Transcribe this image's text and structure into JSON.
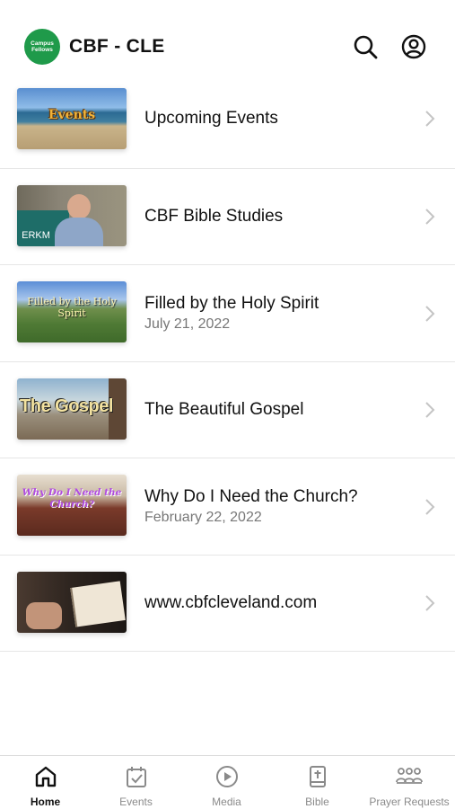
{
  "header": {
    "logo_line1": "Campus",
    "logo_line2": "Fellows",
    "title": "CBF - CLE",
    "search_icon": "search-icon",
    "profile_icon": "profile-icon"
  },
  "items": [
    {
      "title": "Upcoming Events",
      "subtitle": "",
      "thumb_text": "Events"
    },
    {
      "title": "CBF Bible Studies",
      "subtitle": "",
      "thumb_text": "ERKM"
    },
    {
      "title": "Filled by the Holy Spirit",
      "subtitle": "July 21, 2022",
      "thumb_text": "Filled by the Holy Spirit"
    },
    {
      "title": "The Beautiful Gospel",
      "subtitle": "",
      "thumb_text": "The Gospel"
    },
    {
      "title": "Why Do I Need the Church?",
      "subtitle": "February 22, 2022",
      "thumb_text": "Why Do I Need the Church?"
    },
    {
      "title": "www.cbfcleveland.com",
      "subtitle": "",
      "thumb_text": ""
    }
  ],
  "tabs": [
    {
      "label": "Home",
      "icon": "home-icon",
      "active": true
    },
    {
      "label": "Events",
      "icon": "calendar-check-icon",
      "active": false
    },
    {
      "label": "Media",
      "icon": "play-circle-icon",
      "active": false
    },
    {
      "label": "Bible",
      "icon": "bible-icon",
      "active": false
    },
    {
      "label": "Prayer Requests",
      "icon": "people-icon",
      "active": false
    }
  ],
  "colors": {
    "brand_green": "#1f9a4a",
    "inactive_tab": "#8a8a8a"
  }
}
